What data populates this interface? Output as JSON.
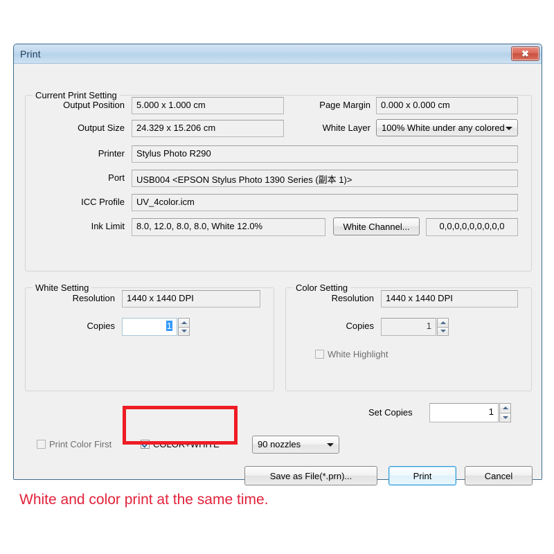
{
  "window": {
    "title": "Print",
    "close_label": "✕"
  },
  "current_print_setting": {
    "group_title": "Current Print Setting",
    "fields": {
      "output_position_label": "Output Position",
      "output_position_value": "5.000 x 1.000 cm",
      "page_margin_label": "Page Margin",
      "page_margin_value": "0.000 x 0.000 cm",
      "output_size_label": "Output Size",
      "output_size_value": "24.329 x 15.206 cm",
      "white_layer_label": "White Layer",
      "white_layer_value": "100% White under any colored",
      "printer_label": "Printer",
      "printer_value": "Stylus Photo R290",
      "port_label": "Port",
      "port_value": "USB004  <EPSON Stylus Photo 1390 Series (副本 1)>",
      "icc_profile_label": "ICC Profile",
      "icc_profile_value": "UV_4color.icm",
      "ink_limit_label": "Ink Limit",
      "ink_limit_value": "8.0, 12.0, 8.0, 8.0, White 12.0%",
      "white_channel_button": "White Channel...",
      "white_channel_value": "0,0,0,0,0,0,0,0,0"
    }
  },
  "white_setting": {
    "group_title": "White Setting",
    "resolution_label": "Resolution",
    "resolution_value": "1440 x 1440 DPI",
    "copies_label": "Copies",
    "copies_value": "1"
  },
  "color_setting": {
    "group_title": "Color Setting",
    "resolution_label": "Resolution",
    "resolution_value": "1440 x 1440 DPI",
    "copies_label": "Copies",
    "copies_value": "1",
    "white_highlight_label": "White Highlight"
  },
  "bottom": {
    "set_copies_label": "Set Copies",
    "set_copies_value": "1",
    "print_color_first_label": "Print Color First",
    "color_white_label": "COLOR+WHITE",
    "nozzles_value": "90 nozzles",
    "save_as_file_button": "Save as File(*.prn)...",
    "print_button": "Print",
    "cancel_button": "Cancel"
  },
  "caption": {
    "text": "White and color print at the same time."
  },
  "colors": {
    "highlight_rect": "#ee1c25",
    "caption_text": "#e2213a",
    "selection_blue": "#3399ff",
    "default_button_border": "#2c9ad6"
  }
}
